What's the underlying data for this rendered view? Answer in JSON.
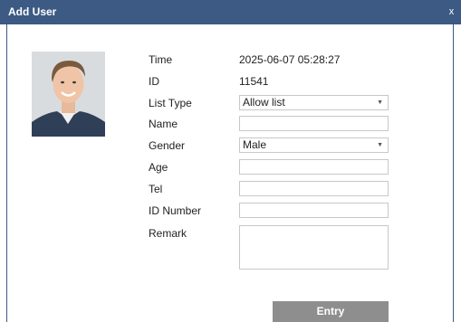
{
  "window": {
    "title": "Add User",
    "close_glyph": "x"
  },
  "avatar": {
    "icon": "user-photo"
  },
  "form": {
    "time": {
      "label": "Time",
      "value": "2025-06-07 05:28:27"
    },
    "id": {
      "label": "ID",
      "value": "11541"
    },
    "list_type": {
      "label": "List Type",
      "value": "Allow list"
    },
    "name": {
      "label": "Name",
      "value": ""
    },
    "gender": {
      "label": "Gender",
      "value": "Male"
    },
    "age": {
      "label": "Age",
      "value": ""
    },
    "tel": {
      "label": "Tel",
      "value": ""
    },
    "id_number": {
      "label": "ID Number",
      "value": ""
    },
    "remark": {
      "label": "Remark",
      "value": ""
    }
  },
  "buttons": {
    "entry": "Entry"
  },
  "colors": {
    "titlebar": "#3c5a83",
    "button": "#8e8e8e"
  }
}
